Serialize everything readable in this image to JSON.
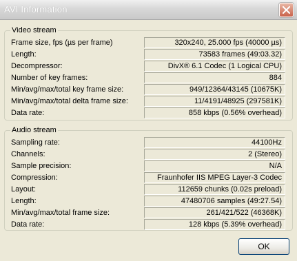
{
  "window": {
    "title": "AVI Information"
  },
  "video": {
    "title": "Video stream",
    "rows": [
      {
        "label": "Frame size, fps (µs per frame)",
        "value": "320x240, 25.000 fps (40000 µs)"
      },
      {
        "label": "Length:",
        "value": "73583 frames (49:03.32)"
      },
      {
        "label": "Decompressor:",
        "value": "DivX® 6.1 Codec (1 Logical CPU)"
      },
      {
        "label": "Number of key frames:",
        "value": "884"
      },
      {
        "label": "Min/avg/max/total key frame size:",
        "value": "949/12364/43145 (10675K)"
      },
      {
        "label": "Min/avg/max/total delta frame size:",
        "value": "11/4191/48925 (297581K)"
      },
      {
        "label": "Data rate:",
        "value": "858 kbps (0.56% overhead)"
      }
    ]
  },
  "audio": {
    "title": "Audio stream",
    "rows": [
      {
        "label": "Sampling rate:",
        "value": "44100Hz"
      },
      {
        "label": "Channels:",
        "value": "2 (Stereo)"
      },
      {
        "label": "Sample precision:",
        "value": "N/A"
      },
      {
        "label": "Compression:",
        "value": "Fraunhofer IIS MPEG Layer-3 Codec"
      },
      {
        "label": "Layout:",
        "value": "112659 chunks (0.02s preload)"
      },
      {
        "label": "Length:",
        "value": "47480706 samples (49:27.54)"
      },
      {
        "label": "Min/avg/max/total frame size:",
        "value": "261/421/522 (46368K)"
      },
      {
        "label": "Data rate:",
        "value": "128 kbps (5.39% overhead)"
      }
    ]
  },
  "buttons": {
    "ok": "OK"
  },
  "icons": {
    "close": "close-icon"
  }
}
